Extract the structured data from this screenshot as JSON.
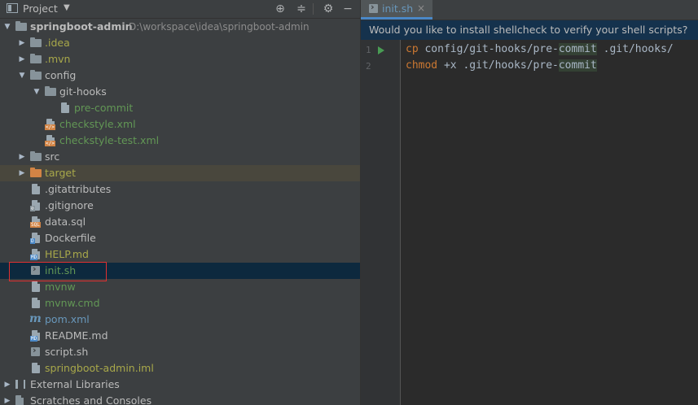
{
  "project_panel": {
    "title": "Project",
    "caret": "▼"
  },
  "tree": [
    {
      "label": "springboot-admin",
      "hint": "D:\\workspace\\idea\\springboot-admin",
      "indent": 0,
      "arrow": "down",
      "icon": "folder-icon",
      "color": "default",
      "bold": true
    },
    {
      "label": ".idea",
      "indent": 1,
      "arrow": "right",
      "icon": "folder-icon",
      "color": "olive"
    },
    {
      "label": ".mvn",
      "indent": 1,
      "arrow": "right",
      "icon": "folder-icon",
      "color": "olive"
    },
    {
      "label": "config",
      "indent": 1,
      "arrow": "down",
      "icon": "folder-icon",
      "color": "default"
    },
    {
      "label": "git-hooks",
      "indent": 2,
      "arrow": "down",
      "icon": "folder-icon",
      "color": "default"
    },
    {
      "label": "pre-commit",
      "indent": 3,
      "icon": "file-icon",
      "color": "green"
    },
    {
      "label": "checkstyle.xml",
      "indent": 2,
      "icon": "xml-file-icon",
      "color": "green"
    },
    {
      "label": "checkstyle-test.xml",
      "indent": 2,
      "icon": "xml-file-icon",
      "color": "green"
    },
    {
      "label": "src",
      "indent": 1,
      "arrow": "right",
      "icon": "folder-icon",
      "color": "default"
    },
    {
      "label": "target",
      "indent": 1,
      "arrow": "right",
      "icon": "excluded-folder-icon",
      "color": "olive",
      "excluded": true
    },
    {
      "label": ".gitattributes",
      "indent": 1,
      "icon": "file-icon",
      "color": "default"
    },
    {
      "label": ".gitignore",
      "indent": 1,
      "icon": "gitignore-file-icon",
      "color": "default"
    },
    {
      "label": "data.sql",
      "indent": 1,
      "icon": "sql-file-icon",
      "color": "default"
    },
    {
      "label": "Dockerfile",
      "indent": 1,
      "icon": "docker-file-icon",
      "color": "default"
    },
    {
      "label": "HELP.md",
      "indent": 1,
      "icon": "markdown-file-icon",
      "color": "olive"
    },
    {
      "label": "init.sh",
      "indent": 1,
      "icon": "shell-script-icon",
      "color": "green",
      "selected": true
    },
    {
      "label": "mvnw",
      "indent": 1,
      "icon": "file-icon",
      "color": "green"
    },
    {
      "label": "mvnw.cmd",
      "indent": 1,
      "icon": "file-icon",
      "color": "green"
    },
    {
      "label": "pom.xml",
      "indent": 1,
      "icon": "maven-icon",
      "color": "blue"
    },
    {
      "label": "README.md",
      "indent": 1,
      "icon": "markdown-file-icon",
      "color": "default"
    },
    {
      "label": "script.sh",
      "indent": 1,
      "icon": "shell-script-icon",
      "color": "default"
    },
    {
      "label": "springboot-admin.iml",
      "indent": 1,
      "icon": "iml-file-icon",
      "color": "olive"
    },
    {
      "label": "External Libraries",
      "indent": 0,
      "arrow": "right",
      "icon": "library-icon",
      "color": "default"
    },
    {
      "label": "Scratches and Consoles",
      "indent": 0,
      "arrow": "right",
      "icon": "scratches-icon",
      "color": "default"
    }
  ],
  "editor": {
    "tab_label": "init.sh",
    "notification": "Would you like to install shellcheck to verify your shell scripts?",
    "line_numbers": [
      "1",
      "2"
    ],
    "lines": [
      [
        {
          "t": "cp",
          "k": "kw"
        },
        {
          "t": " config/git-hooks/pre-",
          "k": ""
        },
        {
          "t": "commit",
          "k": "match"
        },
        {
          "t": " .git/hooks/",
          "k": ""
        }
      ],
      [
        {
          "t": "chmod",
          "k": "kw"
        },
        {
          "t": " +x .git/hooks/pre-",
          "k": ""
        },
        {
          "t": "commit",
          "k": "match"
        }
      ]
    ]
  },
  "colors": {
    "selection": "#0d293e",
    "excluded_row": "#49473d",
    "highlight_box": "#e03030",
    "keyword": "#cc7832",
    "notification_bg": "#15324d"
  }
}
